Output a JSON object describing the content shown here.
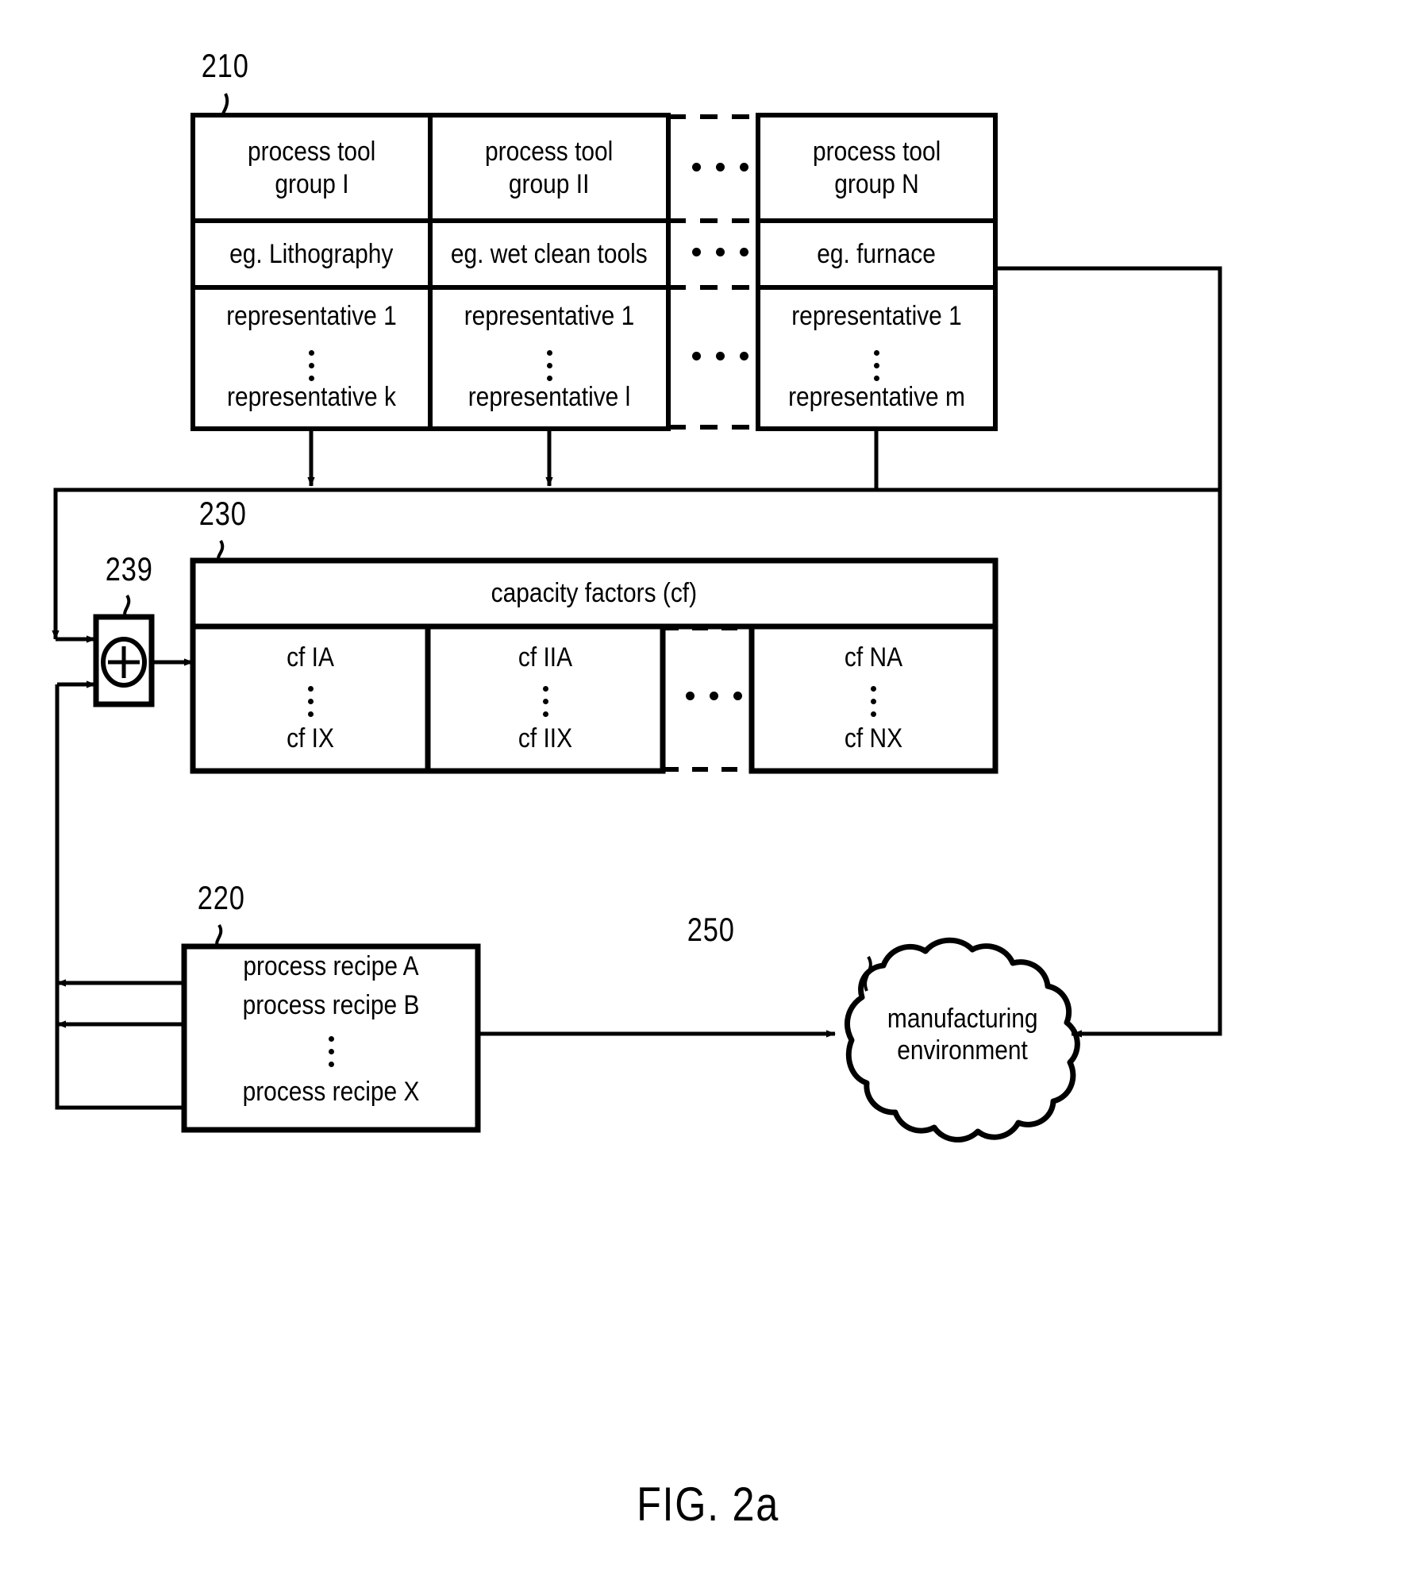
{
  "figure": {
    "caption": "FIG. 2a"
  },
  "refs": {
    "tool_groups": "210",
    "capacity_factors": "230",
    "summing_junction": "239",
    "process_recipes": "220",
    "manufacturing_environment": "250"
  },
  "tool_group_table": {
    "columns": [
      {
        "group": "process tool\ngroup I",
        "group_line1": "process tool",
        "group_line2": "group I",
        "example": "eg. Lithography",
        "representative_first": "representative 1",
        "representative_last": "representative k"
      },
      {
        "group_line1": "process tool",
        "group_line2": "group II",
        "example": "eg. wet clean tools",
        "representative_first": "representative 1",
        "representative_last": "representative l"
      },
      {
        "group_line1": "process tool",
        "group_line2": "group N",
        "example": "eg. furnace",
        "representative_first": "representative 1",
        "representative_last": "representative m"
      }
    ],
    "ellipsis": "..."
  },
  "capacity_factors_box": {
    "header": "capacity factors (cf)",
    "columns": [
      {
        "first": "cf IA",
        "last": "cf IX"
      },
      {
        "first": "cf IIA",
        "last": "cf IIX"
      },
      {
        "first": "cf NA",
        "last": "cf NX"
      }
    ],
    "ellipsis": "..."
  },
  "summing_junction": {
    "symbol": "+"
  },
  "process_recipe_box": {
    "items_top": [
      "process recipe A",
      "process recipe B"
    ],
    "item_last": "process recipe X"
  },
  "manufacturing_environment": {
    "line1": "manufacturing",
    "line2": "environment"
  },
  "colors": {
    "ink": "#000000",
    "paper": "#ffffff"
  }
}
